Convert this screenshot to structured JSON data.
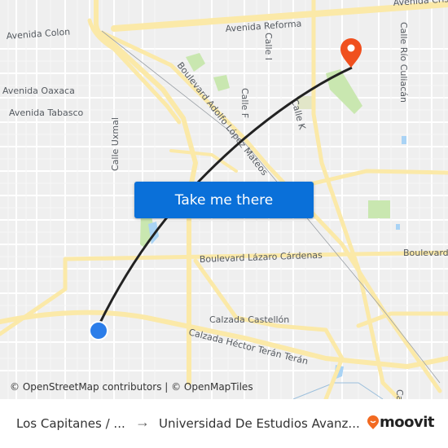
{
  "map": {
    "road_labels": {
      "avenida_colon": "Avenida Colon",
      "avenida_reforma": "Avenida Reforma",
      "avenida_cristobal": "Avenida Cris",
      "avenida_oaxaca": "Avenida Oaxaca",
      "avenida_tabasco": "Avenida Tabasco",
      "calle_uxmal": "Calle Uxmal",
      "boulevard_adolfo": "Boulevard Adolfo López Mateos",
      "calle_i": "Calle I",
      "calle_f": "Calle F",
      "calle_k": "Calle K",
      "calle_rio_culiacan": "Calle Río Culiacán",
      "boulevard_lazaro": "Boulevard Lázaro Cárdenas",
      "boulevard_right": "Boulevard",
      "calzada_castellon": "Calzada Castellón",
      "calzada_hector": "Calzada Héctor Terán Terán",
      "calle_bottom_right": "Ca"
    },
    "colors": {
      "background": "#efefef",
      "major_road": "#fbe9a8",
      "minor_road": "#ffffff",
      "park": "#c9e7b0",
      "water": "#a9d3f5",
      "route_line": "#222222",
      "origin_marker": "#2b7de9",
      "destination_marker": "#f0501e"
    },
    "attribution": "© OpenStreetMap contributors | © OpenMapTiles"
  },
  "cta": {
    "label": "Take me there",
    "color": "#0a70d9"
  },
  "footer": {
    "origin": "Los Capitanes / ...",
    "arrow": "→",
    "destination": "Universidad De Estudios Avanz...",
    "brand": "moovit",
    "brand_color": "#f26a21"
  }
}
